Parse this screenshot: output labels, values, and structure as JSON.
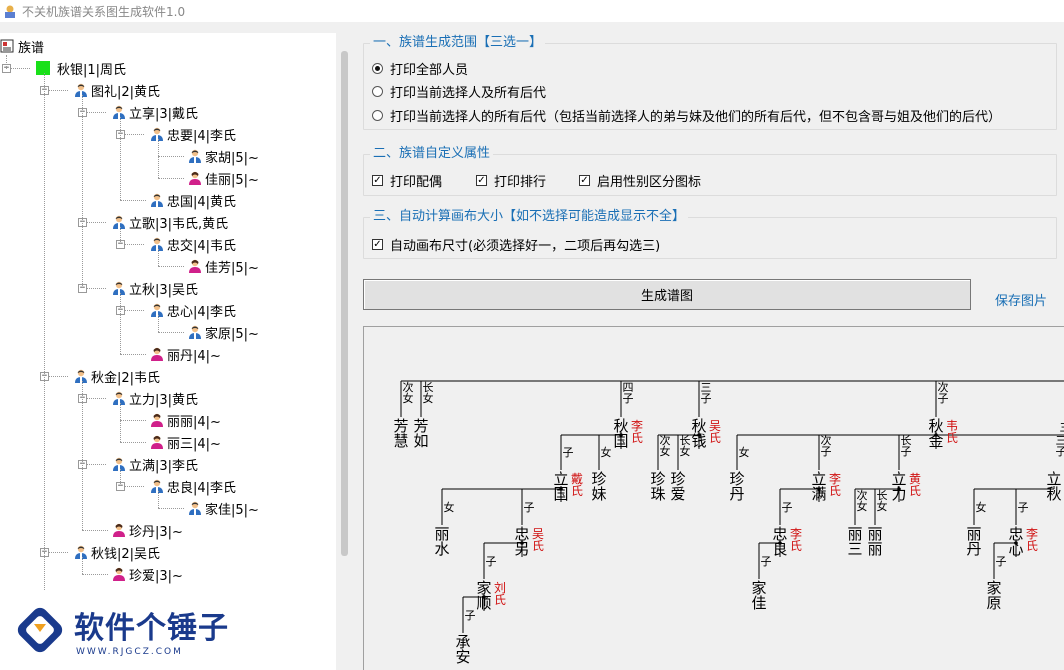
{
  "window": {
    "title": "不关机族谱关系图生成软件1.0"
  },
  "tree": {
    "root": "族谱",
    "nodes": [
      {
        "label": "秋银|1|周氏",
        "icon": "green-square"
      },
      {
        "label": "图礼|2|黄氏",
        "icon": "male"
      },
      {
        "label": "立享|3|戴氏",
        "icon": "male"
      },
      {
        "label": "忠要|4|李氏",
        "icon": "male"
      },
      {
        "label": "家胡|5|~",
        "icon": "male"
      },
      {
        "label": "佳丽|5|~",
        "icon": "female"
      },
      {
        "label": "忠国|4|黄氏",
        "icon": "male"
      },
      {
        "label": "立歌|3|韦氏,黄氏",
        "icon": "male"
      },
      {
        "label": "忠交|4|韦氏",
        "icon": "male"
      },
      {
        "label": "佳芳|5|~",
        "icon": "female"
      },
      {
        "label": "立秋|3|吴氏",
        "icon": "male"
      },
      {
        "label": "忠心|4|李氏",
        "icon": "male"
      },
      {
        "label": "家原|5|~",
        "icon": "male"
      },
      {
        "label": "丽丹|4|~",
        "icon": "female"
      },
      {
        "label": "秋金|2|韦氏",
        "icon": "male"
      },
      {
        "label": "立力|3|黄氏",
        "icon": "male"
      },
      {
        "label": "丽丽|4|~",
        "icon": "female"
      },
      {
        "label": "丽三|4|~",
        "icon": "female"
      },
      {
        "label": "立满|3|李氏",
        "icon": "male"
      },
      {
        "label": "忠良|4|李氏",
        "icon": "male"
      },
      {
        "label": "家佳|5|~",
        "icon": "male"
      },
      {
        "label": "珍丹|3|~",
        "icon": "female"
      },
      {
        "label": "秋钱|2|吴氏",
        "icon": "male"
      },
      {
        "label": "珍爱|3|~",
        "icon": "female"
      }
    ]
  },
  "section1": {
    "legend": "一、族谱生成范围【三选一】",
    "options": [
      "打印全部人员",
      "打印当前选择人及所有后代",
      "打印当前选择人的所有后代（包括当前选择人的弟与妹及他们的所有后代，但不包含哥与姐及他们的后代）"
    ],
    "selected": 0
  },
  "section2": {
    "legend": "二、族谱自定义属性",
    "checks": [
      "打印配偶",
      "打印排行",
      "启用性别区分图标"
    ]
  },
  "section3": {
    "legend": "三、自动计算画布大小【如不选择可能造成显示不全】",
    "check": "自动画布尺寸(必须选择好一，二项后再勾选三)"
  },
  "actions": {
    "generate": "生成谱图",
    "save": "保存图片"
  },
  "chart": {
    "people": [
      {
        "id": "fanghui",
        "name": "芳慧",
        "spouse": "",
        "rel": "次女"
      },
      {
        "id": "fangru",
        "name": "芳如",
        "spouse": "",
        "rel": "长女"
      },
      {
        "id": "qiuguo",
        "name": "秋国",
        "spouse": "李氏",
        "rel": "四子"
      },
      {
        "id": "qiuqian",
        "name": "秋钱",
        "spouse": "吴氏",
        "rel": "三子"
      },
      {
        "id": "qiujin",
        "name": "秋金",
        "spouse": "韦氏",
        "rel": "次子"
      },
      {
        "id": "ligu",
        "name": "立国",
        "spouse": "戴氏",
        "rel": "子"
      },
      {
        "id": "zhenmei",
        "name": "珍妹",
        "spouse": "",
        "rel": "女"
      },
      {
        "id": "zhenzhu",
        "name": "珍珠",
        "spouse": "",
        "rel": "次女"
      },
      {
        "id": "zhenai",
        "name": "珍爱",
        "spouse": "",
        "rel": "长女"
      },
      {
        "id": "zhendan",
        "name": "珍丹",
        "spouse": "",
        "rel": "女"
      },
      {
        "id": "liman",
        "name": "立满",
        "spouse": "李氏",
        "rel": "次子"
      },
      {
        "id": "lili",
        "name": "立力",
        "spouse": "黄氏",
        "rel": "长子"
      },
      {
        "id": "lishui",
        "name": "丽水",
        "spouse": "",
        "rel": "女"
      },
      {
        "id": "zhongling",
        "name": "忠另",
        "spouse": "吴氏",
        "rel": "子"
      },
      {
        "id": "zhongliang",
        "name": "忠良",
        "spouse": "李氏",
        "rel": "子"
      },
      {
        "id": "lisan",
        "name": "丽三",
        "spouse": "",
        "rel": "次女"
      },
      {
        "id": "lili2",
        "name": "丽丽",
        "spouse": "",
        "rel": "长女"
      },
      {
        "id": "jiashun",
        "name": "家顺",
        "spouse": "刘氏",
        "rel": "子"
      },
      {
        "id": "jiajia",
        "name": "家佳",
        "spouse": "",
        "rel": "子"
      },
      {
        "id": "chengan",
        "name": "承安",
        "spouse": "",
        "rel": "子"
      },
      {
        "id": "liqiu",
        "name": "立秋",
        "spouse": "",
        "rel": "三子"
      },
      {
        "id": "lidan",
        "name": "丽丹",
        "spouse": "",
        "rel": "女"
      },
      {
        "id": "zhongxin",
        "name": "忠心",
        "spouse": "李氏",
        "rel": "子"
      },
      {
        "id": "jiayuan",
        "name": "家原",
        "spouse": "",
        "rel": "子"
      }
    ]
  },
  "watermark": {
    "text": "软件个锤子",
    "url": "WWW.RJGCZ.COM"
  }
}
